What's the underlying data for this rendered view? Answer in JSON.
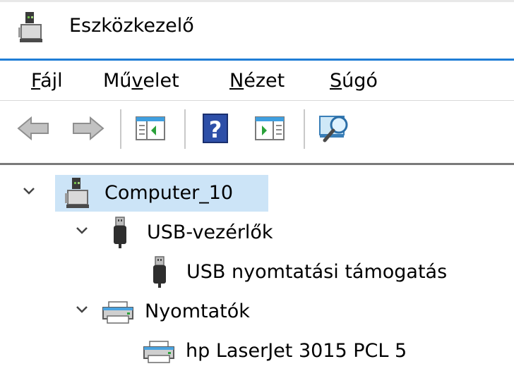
{
  "window": {
    "title": "Eszközkezelő"
  },
  "menu": {
    "items": [
      {
        "pre": "",
        "acc": "F",
        "post": "ájl"
      },
      {
        "pre": "Mű",
        "acc": "v",
        "post": "elet"
      },
      {
        "pre": "",
        "acc": "N",
        "post": "ézet"
      },
      {
        "pre": "",
        "acc": "S",
        "post": "úgó"
      }
    ]
  },
  "tree": {
    "root": {
      "label": "Computer_10",
      "expanded": true,
      "icon": "computer-icon"
    },
    "usb": {
      "label": "USB-vezérlők",
      "expanded": true,
      "icon": "usb-connector-icon"
    },
    "usb_child": {
      "label": "USB nyomtatási támogatás",
      "icon": "usb-connector-icon"
    },
    "printers": {
      "label": "Nyomtatók",
      "expanded": true,
      "icon": "printer-icon"
    },
    "printer_child": {
      "label": "hp LaserJet 3015 PCL 5",
      "icon": "printer-icon"
    }
  },
  "colors": {
    "accent": "#1f7dd6",
    "selection": "#cce4f7"
  }
}
